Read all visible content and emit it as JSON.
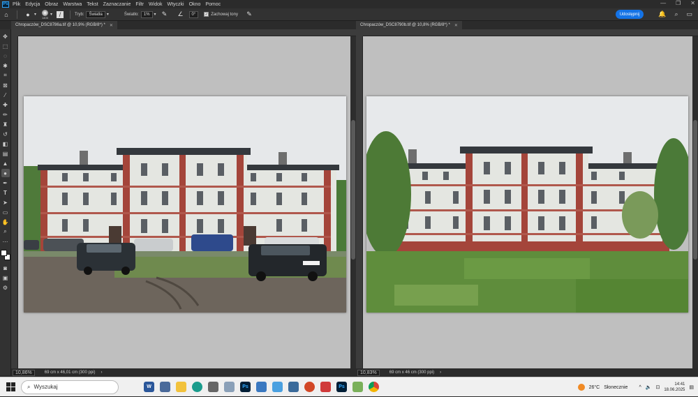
{
  "app": {
    "logo": "Ps",
    "menu": [
      "Plik",
      "Edycja",
      "Obraz",
      "Warstwa",
      "Tekst",
      "Zaznaczanie",
      "Filtr",
      "Widok",
      "Wtyczki",
      "Okno",
      "Pomoc"
    ]
  },
  "options": {
    "brush_size": "1400",
    "mode_label": "Tryb:",
    "mode_value": "Światła",
    "exposure_label": "Światło:",
    "exposure_value": "1%",
    "angle_value": "0°",
    "protect_tones_label": "Zachowaj tony",
    "share_label": "Udostępnij"
  },
  "documents": [
    {
      "tab_title": "Chropaczów_DSC8786a.tif @ 10,9% (RGB/8*) *",
      "zoom": "10,86%",
      "dims": "69 cm x 46,01 cm (300 ppi)"
    },
    {
      "tab_title": "Chropaczów_DSC8790b.tif @ 10,8% (RGB/8*) *",
      "zoom": "10,83%",
      "dims": "69 cm x 46 cm (300 ppi)"
    }
  ],
  "taskbar": {
    "search_placeholder": "Wyszukaj",
    "apps": [
      "W",
      "Ps"
    ],
    "temperature": "26°C",
    "weather": "Słonecznie",
    "time": "14:41",
    "date": "18.06.2025"
  },
  "colors": {
    "accent": "#1473e6",
    "ps_blue": "#31a8ff",
    "brick": "#a4453a",
    "facade": "#e4e6e1",
    "roof": "#34383d"
  }
}
